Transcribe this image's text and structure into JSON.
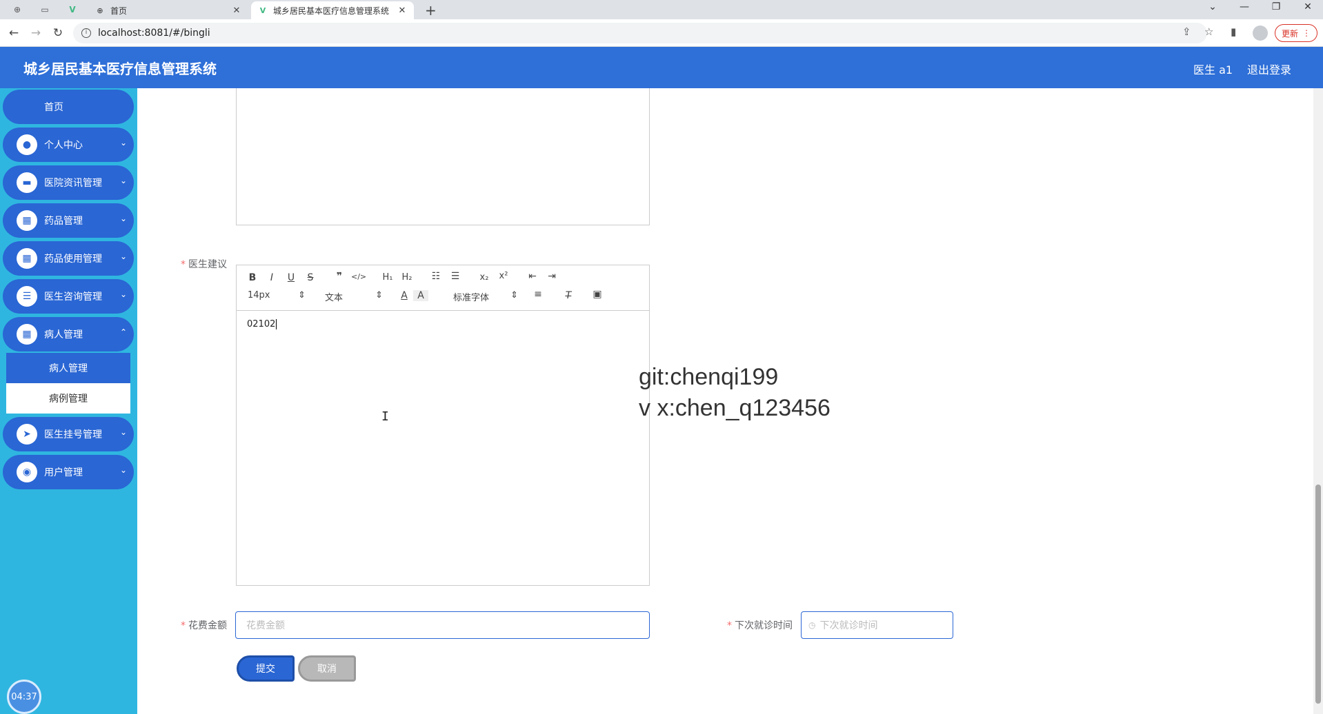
{
  "browser": {
    "tabs": [
      {
        "title": "首页",
        "active": false
      },
      {
        "title": "城乡居民基本医疗信息管理系统",
        "active": true
      }
    ],
    "new_tab": "+",
    "url": "localhost:8081/#/bingli",
    "update_label": "更新"
  },
  "app": {
    "title": "城乡居民基本医疗信息管理系统",
    "user": "医生 a1",
    "logout": "退出登录"
  },
  "sidebar": {
    "items": [
      {
        "label": "首页",
        "icon": "home"
      },
      {
        "label": "个人中心",
        "icon": "user-icon"
      },
      {
        "label": "医院资讯管理",
        "icon": "briefcase-icon"
      },
      {
        "label": "药品管理",
        "icon": "grid-icon"
      },
      {
        "label": "药品使用管理",
        "icon": "grid-icon"
      },
      {
        "label": "医生咨询管理",
        "icon": "list-icon"
      },
      {
        "label": "病人管理",
        "icon": "grid-icon"
      },
      {
        "label": "医生挂号管理",
        "icon": "send-icon"
      },
      {
        "label": "用户管理",
        "icon": "bulb-icon"
      }
    ],
    "submenu": [
      {
        "label": "病人管理",
        "active": true
      },
      {
        "label": "病例管理",
        "active": false
      }
    ],
    "clock": "04:37"
  },
  "form": {
    "doctor_advice_label": "医生建议",
    "toolbar": {
      "font_size": "14px",
      "heading": "文本",
      "font_family": "标准字体"
    },
    "editor_text": "02102",
    "cost_label": "花费金额",
    "cost_placeholder": "花费金额",
    "next_visit_label": "下次就诊时间",
    "next_visit_placeholder": "下次就诊时间",
    "submit": "提交",
    "cancel": "取消"
  },
  "overlay": {
    "line1": "git:chenqi199",
    "line2": "v x:chen_q123456"
  }
}
